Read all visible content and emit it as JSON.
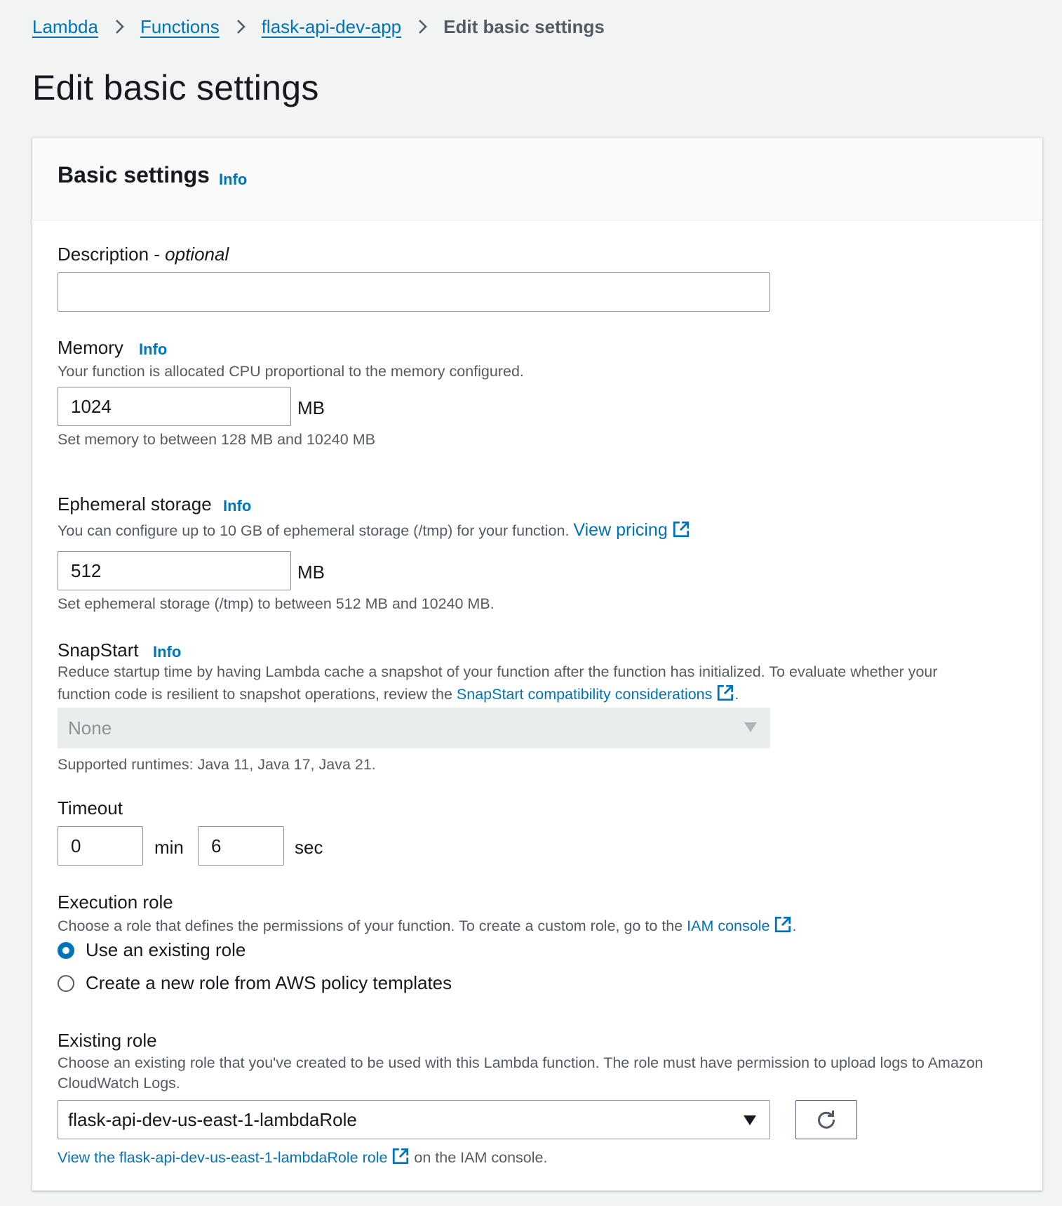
{
  "breadcrumb": {
    "items": [
      "Lambda",
      "Functions",
      "flask-api-dev-app"
    ],
    "current": "Edit basic settings"
  },
  "page_title": "Edit basic settings",
  "panel": {
    "title": "Basic settings",
    "info": "Info"
  },
  "description": {
    "label": "Description - ",
    "label_optional": "optional",
    "value": ""
  },
  "memory": {
    "label": "Memory",
    "info": "Info",
    "description": "Your function is allocated CPU proportional to the memory configured.",
    "value": "1024",
    "unit": "MB",
    "hint": "Set memory to between 128 MB and 10240 MB"
  },
  "ephemeral_storage": {
    "label": "Ephemeral storage",
    "info": "Info",
    "description": "You can configure up to 10 GB of ephemeral storage (/tmp) for your function. ",
    "link": "View pricing",
    "value": "512",
    "unit": "MB",
    "hint": "Set ephemeral storage (/tmp) to between 512 MB and 10240 MB."
  },
  "snapstart": {
    "label": "SnapStart",
    "info": "Info",
    "description_line1": "Reduce startup time by having Lambda cache a snapshot of your function after the function has initialized. To evaluate whether your",
    "description_line2": "function code is resilient to snapshot operations, review the ",
    "link": "SnapStart compatibility considerations",
    "trailing": ".",
    "value": "None",
    "hint": "Supported runtimes: Java 11, Java 17, Java 21."
  },
  "timeout": {
    "label": "Timeout",
    "min_value": "0",
    "min_unit": "min",
    "sec_value": "6",
    "sec_unit": "sec"
  },
  "execution_role": {
    "label": "Execution role",
    "description": "Choose a role that defines the permissions of your function. To create a custom role, go to the ",
    "link": "IAM console",
    "trailing": ".",
    "options": [
      "Use an existing role",
      "Create a new role from AWS policy templates"
    ],
    "selected_index": 0
  },
  "existing_role": {
    "label": "Existing role",
    "description_line1": "Choose an existing role that you've created to be used with this Lambda function. The role must have permission to upload logs to Amazon",
    "description_line2": "CloudWatch Logs.",
    "value": "flask-api-dev-us-east-1-lambdaRole",
    "view_link": "View the flask-api-dev-us-east-1-lambdaRole role",
    "view_trailing": " on the IAM console."
  },
  "colors": {
    "link": "#0073bb",
    "background": "#f2f3f3",
    "text": "#16191f",
    "secondary_text": "#545b64",
    "disabled_bg": "#eaeded"
  },
  "icons": [
    "chevron-right-icon",
    "external-link-icon",
    "caret-down-icon",
    "refresh-icon"
  ]
}
